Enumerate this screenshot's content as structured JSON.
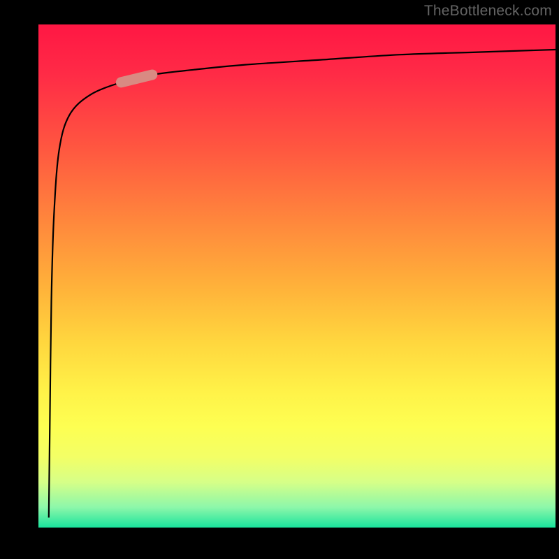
{
  "watermark": "TheBottleneck.com",
  "chart_data": {
    "type": "line",
    "title": "",
    "xlabel": "",
    "ylabel": "",
    "xlim": [
      0,
      100
    ],
    "ylim": [
      0,
      100
    ],
    "series": [
      {
        "name": "curve",
        "x": [
          2,
          2.2,
          2.5,
          3,
          4,
          6,
          10,
          16,
          22,
          30,
          40,
          55,
          70,
          85,
          100
        ],
        "y": [
          2,
          20,
          45,
          62,
          75,
          82,
          86,
          88.5,
          90,
          91,
          92,
          93,
          94,
          94.5,
          95
        ]
      }
    ],
    "highlight_segment": {
      "series": "curve",
      "x_start": 16,
      "x_end": 22,
      "color": "#d98a82"
    },
    "background_gradient": {
      "direction": "vertical",
      "stops": [
        {
          "pos": 0,
          "color": "#ff1744"
        },
        {
          "pos": 0.5,
          "color": "#ffb13a"
        },
        {
          "pos": 0.75,
          "color": "#fff248"
        },
        {
          "pos": 1,
          "color": "#19e39c"
        }
      ]
    }
  }
}
